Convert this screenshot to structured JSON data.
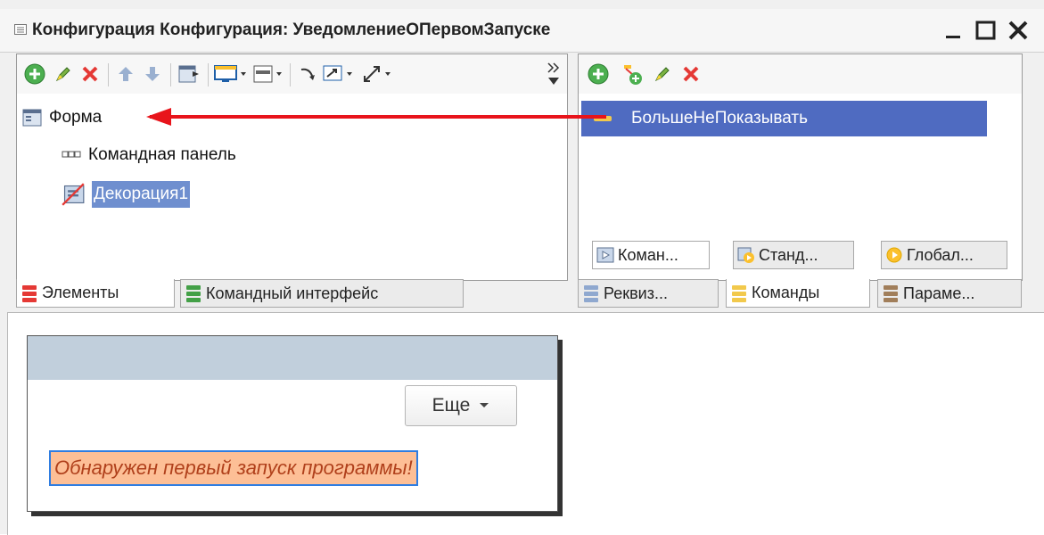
{
  "window": {
    "title": "Конфигурация Конфигурация: УведомлениеОПервомЗапуске",
    "minimize_icon": "minimize-icon",
    "maximize_icon": "maximize-icon",
    "close_icon": "close-icon"
  },
  "elements_panel": {
    "toolbar": [
      "add-icon",
      "edit-icon",
      "delete-icon",
      "move-up-icon",
      "move-down-icon",
      "form-layout-icon",
      "screen-icon",
      "layout-icon",
      "arrow-icon",
      "select-icon",
      "expand-icon",
      "more-icon"
    ],
    "tree": [
      {
        "label": "Форма",
        "icon": "form-icon"
      },
      {
        "label": "Командная панель",
        "icon": "command-panel-icon"
      },
      {
        "label": "Декорация1",
        "icon": "decoration-icon",
        "selected": true
      }
    ],
    "tabs": [
      {
        "label": "Элементы",
        "active": true
      },
      {
        "label": "Командный интерфейс",
        "active": false
      }
    ]
  },
  "commands_panel": {
    "toolbar": [
      "add-icon",
      "add-special-icon",
      "edit-icon",
      "delete-icon"
    ],
    "items": [
      {
        "label": "БольшеНеПоказывать",
        "selected": true
      }
    ],
    "subtabs": [
      {
        "label": "Коман...",
        "active": true
      },
      {
        "label": "Станд...",
        "active": false
      },
      {
        "label": "Глобал...",
        "active": false
      }
    ],
    "tabs": [
      {
        "label": "Реквиз...",
        "active": false
      },
      {
        "label": "Команды",
        "active": true
      },
      {
        "label": "Параме...",
        "active": false
      }
    ]
  },
  "preview": {
    "more_button": "Еще",
    "decoration_text": "Обнаружен первый запуск программы!"
  },
  "colors": {
    "selection": "#4f6bc1",
    "arrow": "#e8141b",
    "decoration_bg": "#fdbf96",
    "decoration_text": "#b0401b",
    "form_header": "#c1cfdc"
  }
}
